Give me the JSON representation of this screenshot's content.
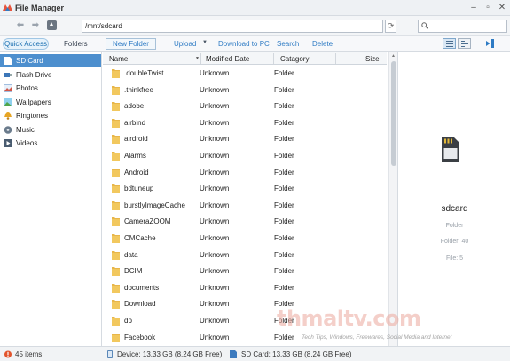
{
  "window": {
    "title": "File Manager"
  },
  "pathbar": {
    "path": "/mnt/sdcard",
    "search_value": ""
  },
  "toolbar": {
    "tabs": [
      "Quick Access",
      "Folders"
    ],
    "actions": [
      "New Folder",
      "Upload",
      "Download to PC",
      "Search",
      "Delete"
    ]
  },
  "sidebar": {
    "items": [
      {
        "label": "SD Card",
        "icon": "sdcard-icon",
        "selected": true
      },
      {
        "label": "Flash Drive",
        "icon": "flash-drive-icon"
      },
      {
        "label": "Photos",
        "icon": "photos-icon"
      },
      {
        "label": "Wallpapers",
        "icon": "wallpapers-icon"
      },
      {
        "label": "Ringtones",
        "icon": "ringtones-icon"
      },
      {
        "label": "Music",
        "icon": "music-icon"
      },
      {
        "label": "Videos",
        "icon": "videos-icon"
      }
    ]
  },
  "filelist": {
    "columns": [
      "Name",
      "Modified Date",
      "Catagory",
      "Size"
    ],
    "rows": [
      {
        "name": ".doubleTwist",
        "date": "Unknown",
        "category": "Folder"
      },
      {
        "name": ".thinkfree",
        "date": "Unknown",
        "category": "Folder"
      },
      {
        "name": "adobe",
        "date": "Unknown",
        "category": "Folder"
      },
      {
        "name": "airbind",
        "date": "Unknown",
        "category": "Folder"
      },
      {
        "name": "airdroid",
        "date": "Unknown",
        "category": "Folder"
      },
      {
        "name": "Alarms",
        "date": "Unknown",
        "category": "Folder"
      },
      {
        "name": "Android",
        "date": "Unknown",
        "category": "Folder"
      },
      {
        "name": "bdtuneup",
        "date": "Unknown",
        "category": "Folder"
      },
      {
        "name": "burstlyImageCache",
        "date": "Unknown",
        "category": "Folder"
      },
      {
        "name": "CameraZOOM",
        "date": "Unknown",
        "category": "Folder"
      },
      {
        "name": "CMCache",
        "date": "Unknown",
        "category": "Folder"
      },
      {
        "name": "data",
        "date": "Unknown",
        "category": "Folder"
      },
      {
        "name": "DCIM",
        "date": "Unknown",
        "category": "Folder"
      },
      {
        "name": "documents",
        "date": "Unknown",
        "category": "Folder"
      },
      {
        "name": "Download",
        "date": "Unknown",
        "category": "Folder"
      },
      {
        "name": "dp",
        "date": "Unknown",
        "category": "Folder"
      },
      {
        "name": "Facebook",
        "date": "Unknown",
        "category": "Folder"
      }
    ]
  },
  "detail": {
    "name": "sdcard",
    "type": "Folder",
    "folder_count": "Folder: 40",
    "file_count": "File: 5"
  },
  "watermark": {
    "name": "thmaltv.com",
    "tagline": "Tech Tips, Windows, Freewares, Social Media and Internet"
  },
  "status": {
    "items_count": "45 items",
    "device": "Device: 13.33 GB (8.24 GB Free)",
    "sdcard": "SD Card: 13.33 GB (8.24 GB Free)"
  },
  "colors": {
    "accent": "#4d8fce",
    "link": "#2e7bc4",
    "folder": "#e8b64a"
  }
}
